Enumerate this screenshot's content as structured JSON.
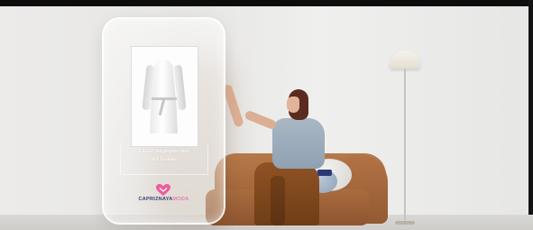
{
  "panel": {
    "product_name_line1": "Халат медицинский",
    "product_name_line2": "№8 Бланш",
    "brand_part1": "CAPRIZNAYA",
    "brand_part2": "MODA"
  },
  "colors": {
    "brand_dark": "#3c3f6b",
    "brand_pink": "#e67fb0",
    "sofa": "#a86a3c",
    "top_shirt": "#9eadbd"
  },
  "icons": [
    "heart-icon"
  ]
}
